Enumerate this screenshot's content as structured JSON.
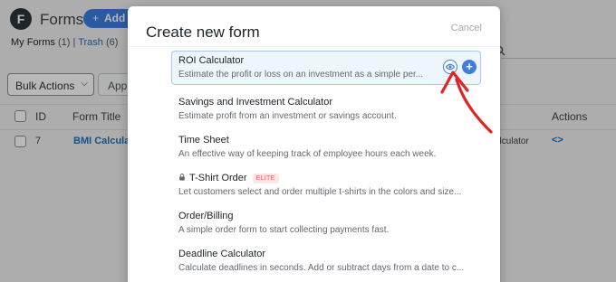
{
  "background": {
    "logo_letter": "F",
    "title": "Forms",
    "add_button": "Add N",
    "my_forms": "My Forms",
    "my_forms_count": "(1)",
    "separator": "|",
    "trash": "Trash",
    "trash_count": "(6)",
    "bulk_actions": "Bulk Actions",
    "apply": "Apply",
    "columns": {
      "id": "ID",
      "title": "Form Title",
      "actions": "Actions"
    },
    "row": {
      "id": "7",
      "title": "BMI Calculator",
      "tail": "alculator",
      "code_icon": "<>"
    }
  },
  "modal": {
    "title": "Create new form",
    "cancel": "Cancel",
    "templates": [
      {
        "name": "ROI Calculator",
        "desc": "Estimate the profit or loss on an investment as a simple per..."
      },
      {
        "name": "Savings and Investment Calculator",
        "desc": "Estimate profit from an investment or savings account."
      },
      {
        "name": "Time Sheet",
        "desc": "An effective way of keeping track of employee hours each week."
      },
      {
        "name": "T-Shirt Order",
        "desc": "Let customers select and order multiple t-shirts in the colors and size...",
        "badge": "ELITE",
        "locked": true
      },
      {
        "name": "Order/Billing",
        "desc": "A simple order form to start collecting payments fast."
      },
      {
        "name": "Deadline Calculator",
        "desc": "Calculate deadlines in seconds. Add or subtract days from a date to c..."
      }
    ],
    "preview_icon": "eye-icon",
    "add_icon": "+"
  },
  "colors": {
    "accent": "#3f7fd9",
    "annotation": "#e02424",
    "elite": "#e35d5d"
  }
}
